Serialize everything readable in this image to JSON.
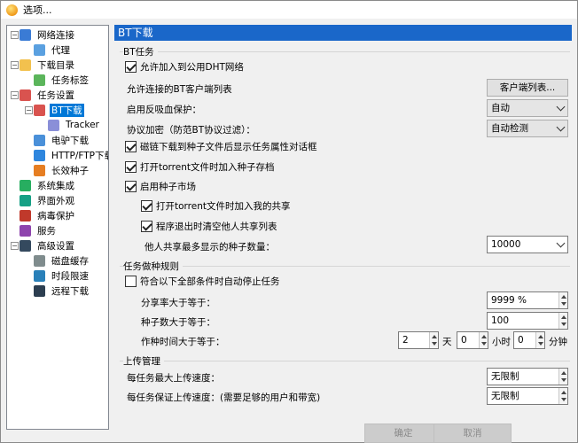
{
  "window": {
    "title": "选项..."
  },
  "tree": {
    "items": [
      {
        "label": "网络连接",
        "icon": "network-icon"
      },
      {
        "label": "代理",
        "icon": "proxy-icon"
      },
      {
        "label": "下载目录",
        "icon": "folder-icon"
      },
      {
        "label": "任务标签",
        "icon": "tag-icon"
      },
      {
        "label": "任务设置",
        "icon": "task-settings-icon"
      },
      {
        "label": "BT下载",
        "icon": "bt-icon"
      },
      {
        "label": "Tracker",
        "icon": "tracker-icon"
      },
      {
        "label": "电驴下载",
        "icon": "emule-icon"
      },
      {
        "label": "HTTP/FTP下载",
        "icon": "http-ftp-icon"
      },
      {
        "label": "长效种子",
        "icon": "seed-icon"
      },
      {
        "label": "系统集成",
        "icon": "system-integration-icon"
      },
      {
        "label": "界面外观",
        "icon": "appearance-icon"
      },
      {
        "label": "病毒保护",
        "icon": "virus-protection-icon"
      },
      {
        "label": "服务",
        "icon": "service-icon"
      },
      {
        "label": "高级设置",
        "icon": "advanced-settings-icon"
      },
      {
        "label": "磁盘缓存",
        "icon": "disk-cache-icon"
      },
      {
        "label": "时段限速",
        "icon": "schedule-icon"
      },
      {
        "label": "远程下载",
        "icon": "remote-download-icon"
      }
    ]
  },
  "panel": {
    "header": "BT下载",
    "bt_group": {
      "title": "BT任务",
      "dht_label": "允许加入到公用DHT网络",
      "clients_label": "允许连接的BT客户端列表",
      "clients_button": "客户端列表...",
      "anti_leech_label": "启用反吸血保护：",
      "anti_leech_value": "自动",
      "encryption_label": "协议加密（防范BT协议过滤）：",
      "encryption_value": "自动检测",
      "magnet_label": "磁链下载到种子文件后显示任务属性对话框",
      "open_torrent_label": "打开torrent文件时加入种子存档",
      "market_label": "启用种子市场",
      "share_label": "打开torrent文件时加入我的共享",
      "clear_label": "程序退出时清空他人共享列表",
      "max_seeds_label": "他人共享最多显示的种子数量：",
      "max_seeds_value": "10000"
    },
    "seed_group": {
      "title": "任务做种规则",
      "stop_label": "符合以下全部条件时自动停止任务",
      "ratio_label": "分享率大于等于：",
      "ratio_value": "9999 %",
      "seeds_label": "种子数大于等于：",
      "seeds_value": "100",
      "time_label": "作种时间大于等于：",
      "days_value": "2",
      "days_unit": "天",
      "hours_value": "0",
      "hours_unit": "小时",
      "minutes_value": "0",
      "minutes_unit": "分钟"
    },
    "upload_group": {
      "title": "上传管理",
      "max_upload_label": "每任务最大上传速度：",
      "max_upload_value": "无限制",
      "guaranteed_label": "每任务保证上传速度：(需要足够的用户和带宽)",
      "guaranteed_value": "无限制"
    }
  },
  "buttons": {
    "ok": "确定",
    "cancel": "取消"
  }
}
